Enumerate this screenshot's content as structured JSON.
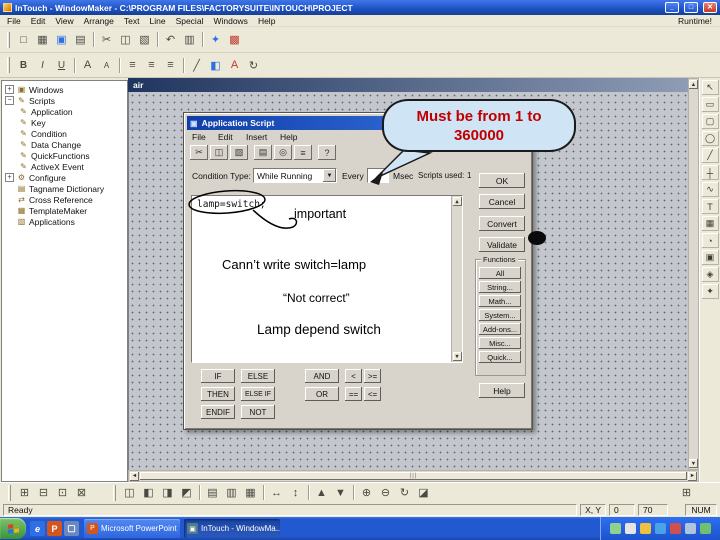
{
  "colors": {
    "titlebar_blue": "#1d51c6",
    "taskbar_blue": "#2258d0",
    "callout_bg": "#cfe4f4",
    "callout_text": "#c00000",
    "close_red": "#c33a22"
  },
  "titlebar": {
    "title": "InTouch - WindowMaker - C:\\PROGRAM FILES\\FACTORYSUITE\\INTOUCH\\PROJECT",
    "minimize": "_",
    "maximize": "□",
    "close": "✕"
  },
  "menubar": {
    "items": [
      "File",
      "Edit",
      "View",
      "Arrange",
      "Text",
      "Line",
      "Special",
      "Windows",
      "Help"
    ],
    "runtime": "Runtime!"
  },
  "scroll": {
    "up": "▲",
    "down": "▼",
    "left": "◄",
    "right": "►",
    "hgrip": "|||"
  },
  "toolbar_main": {
    "icons": [
      {
        "name": "new-icon",
        "glyph": "□"
      },
      {
        "name": "open-icon",
        "glyph": "▦"
      },
      {
        "name": "save-icon",
        "glyph": "▣"
      },
      {
        "name": "print-icon",
        "glyph": "▤"
      },
      {
        "name": "cut-icon",
        "glyph": "✂"
      },
      {
        "name": "copy-icon",
        "glyph": "◫"
      },
      {
        "name": "paste-icon",
        "glyph": "▧"
      },
      {
        "name": "undo-icon",
        "glyph": "↶"
      },
      {
        "name": "duplicate-icon",
        "glyph": "▥"
      },
      {
        "name": "wizard-icon",
        "glyph": "✦"
      },
      {
        "name": "windowmaker-icon",
        "glyph": "▩"
      }
    ]
  },
  "toolbar_format": {
    "icons": [
      {
        "name": "bold-icon",
        "glyph": "B"
      },
      {
        "name": "italic-icon",
        "glyph": "I"
      },
      {
        "name": "underline-icon",
        "glyph": "U"
      },
      {
        "name": "font-increase-icon",
        "glyph": "A"
      },
      {
        "name": "font-decrease-icon",
        "glyph": "A"
      },
      {
        "name": "align-left-icon",
        "glyph": "≡"
      },
      {
        "name": "align-center-icon",
        "glyph": "≡"
      },
      {
        "name": "align-right-icon",
        "glyph": "≡"
      },
      {
        "name": "line-color-icon",
        "glyph": "╱"
      },
      {
        "name": "fill-color-icon",
        "glyph": "◧"
      },
      {
        "name": "text-color-icon",
        "glyph": "A"
      },
      {
        "name": "rotate-icon",
        "glyph": "↻"
      }
    ]
  },
  "tree": {
    "items": [
      {
        "expand": "+",
        "icon": "▣",
        "label": "Windows",
        "indent": 0
      },
      {
        "expand": "−",
        "icon": "✎",
        "label": "Scripts",
        "indent": 0
      },
      {
        "expand": "",
        "icon": "✎",
        "label": "Application",
        "indent": 1
      },
      {
        "expand": "",
        "icon": "✎",
        "label": "Key",
        "indent": 1
      },
      {
        "expand": "",
        "icon": "✎",
        "label": "Condition",
        "indent": 1
      },
      {
        "expand": "",
        "icon": "✎",
        "label": "Data Change",
        "indent": 1
      },
      {
        "expand": "",
        "icon": "✎",
        "label": "QuickFunctions",
        "indent": 1
      },
      {
        "expand": "",
        "icon": "✎",
        "label": "ActiveX Event",
        "indent": 1
      },
      {
        "expand": "+",
        "icon": "⚙",
        "label": "Configure",
        "indent": 0
      },
      {
        "expand": "",
        "icon": "▤",
        "label": "Tagname Dictionary",
        "indent": 0
      },
      {
        "expand": "",
        "icon": "⇄",
        "label": "Cross Reference",
        "indent": 0
      },
      {
        "expand": "",
        "icon": "▦",
        "label": "TemplateMaker",
        "indent": 0
      },
      {
        "expand": "",
        "icon": "▧",
        "label": "Applications",
        "indent": 0
      }
    ]
  },
  "canvas": {
    "title": "air"
  },
  "palette": {
    "tools": [
      {
        "name": "pointer-tool-icon",
        "glyph": "↖"
      },
      {
        "name": "rectangle-tool-icon",
        "glyph": "▭"
      },
      {
        "name": "rounded-rectangle-tool-icon",
        "glyph": "▢"
      },
      {
        "name": "ellipse-tool-icon",
        "glyph": "◯"
      },
      {
        "name": "line-tool-icon",
        "glyph": "╱"
      },
      {
        "name": "hv-line-tool-icon",
        "glyph": "┼"
      },
      {
        "name": "polyline-tool-icon",
        "glyph": "∿"
      },
      {
        "name": "text-tool-icon",
        "glyph": "T"
      },
      {
        "name": "bitmap-tool-icon",
        "glyph": "▦"
      },
      {
        "name": "trend-tool-icon",
        "glyph": "◔"
      },
      {
        "name": "button-tool-icon",
        "glyph": "▣"
      },
      {
        "name": "symbol-tool-icon",
        "glyph": "◈"
      },
      {
        "name": "wizard-tool-icon",
        "glyph": "✦"
      }
    ]
  },
  "dialog": {
    "title": "Application Script",
    "titlebar_icon": "▣",
    "menus": [
      "File",
      "Edit",
      "Insert",
      "Help"
    ],
    "toolbar_icons": [
      {
        "name": "cut-icon",
        "glyph": "✂"
      },
      {
        "name": "copy-icon",
        "glyph": "◫"
      },
      {
        "name": "paste-icon",
        "glyph": "▧"
      },
      {
        "name": "print-icon",
        "glyph": "▤"
      },
      {
        "name": "find-icon",
        "glyph": "◎"
      },
      {
        "name": "tagname-icon",
        "glyph": "≡"
      },
      {
        "name": "help-icon",
        "glyph": "?"
      }
    ],
    "condition_type_label": "Condition Type:",
    "condition_type_value": "While Running",
    "dropdown_arrow": "▼",
    "every_label": "Every",
    "every_value": "",
    "msec_label": "Msec",
    "scripts_used_label": "Scripts used:",
    "scripts_used_value": "1",
    "script_text": "lamp=switch;",
    "buttons": {
      "ok": "OK",
      "cancel": "Cancel",
      "convert": "Convert",
      "validate": "Validate",
      "help": "Help"
    },
    "functions": {
      "group_label": "Functions",
      "buttons": [
        "All",
        "String...",
        "Math...",
        "System...",
        "Add-ons...",
        "Misc...",
        "Quick..."
      ]
    },
    "keywords": {
      "row1": [
        "IF",
        "ELSE",
        "AND",
        "<",
        ">="
      ],
      "row2": [
        "THEN",
        "ELSE IF",
        "OR",
        "==",
        "<="
      ],
      "row3": [
        "ENDIF",
        "NOT"
      ]
    }
  },
  "annotations": {
    "callout_text": "Must be from 1 to 360000",
    "important_text": "important",
    "note_line1": "Cann’t write switch=lamp",
    "note_line2": "“Not correct”",
    "note_line3": "Lamp depend switch"
  },
  "toolbar_bottom": {
    "group1": [
      {
        "name": "grid-toggle-icon",
        "glyph": "⊞"
      },
      {
        "name": "ruler-icon",
        "glyph": "⊟"
      },
      {
        "name": "snap-icon",
        "glyph": "⊡"
      },
      {
        "name": "guide-icon",
        "glyph": "⊠"
      }
    ],
    "group2": [
      {
        "name": "duplicate-icon",
        "glyph": "◫"
      },
      {
        "name": "align-left-icon",
        "glyph": "◧"
      },
      {
        "name": "align-center-icon",
        "glyph": "◨"
      },
      {
        "name": "align-right-icon",
        "glyph": "◩"
      },
      {
        "name": "align-top-icon",
        "glyph": "▤"
      },
      {
        "name": "align-middle-icon",
        "glyph": "▥"
      },
      {
        "name": "align-bottom-icon",
        "glyph": "▦"
      },
      {
        "name": "space-horizontal-icon",
        "glyph": "↔"
      },
      {
        "name": "space-vertical-icon",
        "glyph": "↕"
      },
      {
        "name": "bring-front-icon",
        "glyph": "▲"
      },
      {
        "name": "send-back-icon",
        "glyph": "▼"
      },
      {
        "name": "group-icon",
        "glyph": "⊕"
      },
      {
        "name": "ungroup-icon",
        "glyph": "⊖"
      },
      {
        "name": "rotate-cw-icon",
        "glyph": "↻"
      },
      {
        "name": "flip-horizontal-icon",
        "glyph": "◪"
      }
    ],
    "right": [
      {
        "name": "zoom-icon",
        "glyph": "⊞"
      }
    ]
  },
  "statusbar": {
    "ready": "Ready",
    "xy_label": "X, Y",
    "x_value": "0",
    "y_value": "70",
    "num": "NUM"
  },
  "taskbar": {
    "quick_launch": [
      {
        "name": "internet-explorer-icon",
        "glyph": "e"
      },
      {
        "name": "powerpoint-icon",
        "glyph": "P"
      },
      {
        "name": "show-desktop-icon",
        "glyph": "▢"
      }
    ],
    "tasks": [
      {
        "icon": "P",
        "label": "Microsoft PowerPoint"
      },
      {
        "icon": "▣",
        "label": "InTouch - WindowMa..."
      }
    ]
  }
}
